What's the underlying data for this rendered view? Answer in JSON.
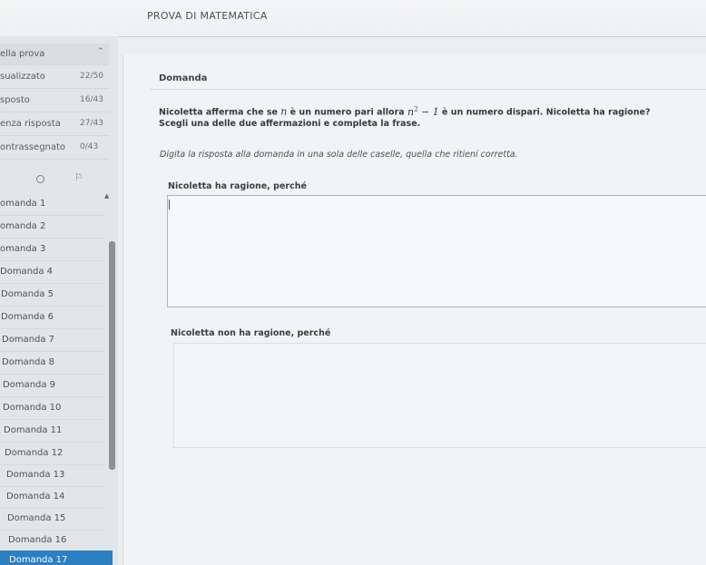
{
  "header": {
    "title": "PROVA DI MATEMATICA"
  },
  "sidebar": {
    "summary_label": "ella prova",
    "summary_toggle_icon": "chevron-up-icon",
    "stats": [
      {
        "label": "sualizzato",
        "count": "22/50"
      },
      {
        "label": "sposto",
        "count": "16/43"
      },
      {
        "label": "enza risposta",
        "count": "27/43"
      },
      {
        "label": "ontrassegnato",
        "count": "0/43"
      }
    ],
    "tools": [
      "circle-icon",
      "flag-icon"
    ],
    "questions": [
      {
        "label": "omanda 1"
      },
      {
        "label": "omanda 2"
      },
      {
        "label": "omanda 3"
      },
      {
        "label": "Domanda 4"
      },
      {
        "label": "Domanda 5"
      },
      {
        "label": "Domanda 6"
      },
      {
        "label": "Domanda 7"
      },
      {
        "label": "Domanda 8"
      },
      {
        "label": "Domanda 9"
      },
      {
        "label": "Domanda 10"
      },
      {
        "label": "Domanda 11"
      },
      {
        "label": "Domanda 12"
      },
      {
        "label": "Domanda 13"
      },
      {
        "label": "Domanda 14"
      },
      {
        "label": "Domanda 15"
      },
      {
        "label": "Domanda 16"
      },
      {
        "label": "Domanda 17"
      }
    ],
    "active_question": "Domanda 17"
  },
  "question": {
    "heading": "Domanda",
    "text_before": "Nicoletta afferma che se ",
    "math_n": "n",
    "text_mid": " è un numero pari allora ",
    "math_expr": "n",
    "math_exp": "2",
    "math_rest": " − 1",
    "text_after": " è un numero dispari. Nicoletta ha ragione?",
    "subtext": "Scegli una delle due affermazioni e completa la frase.",
    "instruction": "Digita la risposta alla domanda in una sola delle caselle, quella che ritieni corretta.",
    "option_yes_label": "Nicoletta ha ragione, perché",
    "option_no_label": "Nicoletta non ha ragione, perché",
    "option_yes_value": "",
    "option_no_value": ""
  }
}
